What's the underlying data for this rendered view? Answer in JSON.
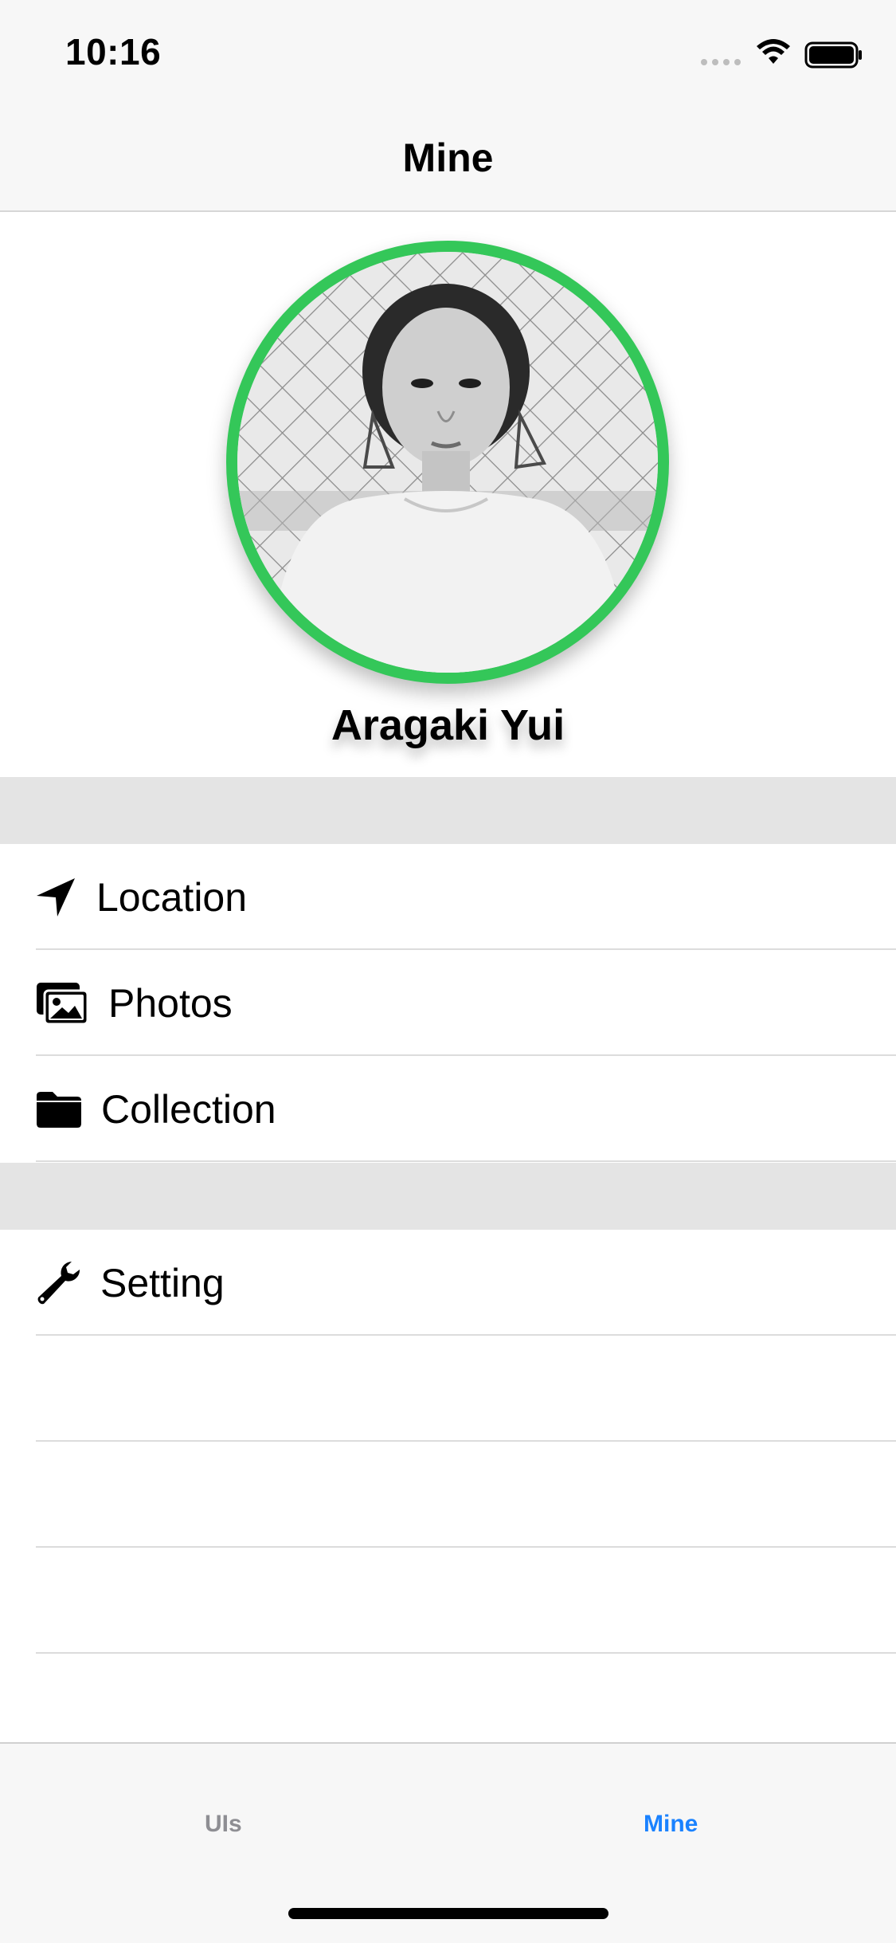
{
  "status_bar": {
    "time": "10:16"
  },
  "nav": {
    "title": "Mine"
  },
  "profile": {
    "name": "Aragaki Yui"
  },
  "menu_section_1": [
    {
      "label": "Location",
      "icon": "location-arrow-icon"
    },
    {
      "label": "Photos",
      "icon": "photos-icon"
    },
    {
      "label": "Collection",
      "icon": "folder-icon"
    }
  ],
  "menu_section_2": [
    {
      "label": "Setting",
      "icon": "wrench-icon"
    }
  ],
  "tabbar": {
    "items": [
      {
        "label": "UIs",
        "active": false
      },
      {
        "label": "Mine",
        "active": true
      }
    ]
  },
  "colors": {
    "accent": "#1a82ff",
    "avatar_ring": "#34c759",
    "inactive_tab": "#8e8e93",
    "section_gap": "#e4e4e4"
  }
}
